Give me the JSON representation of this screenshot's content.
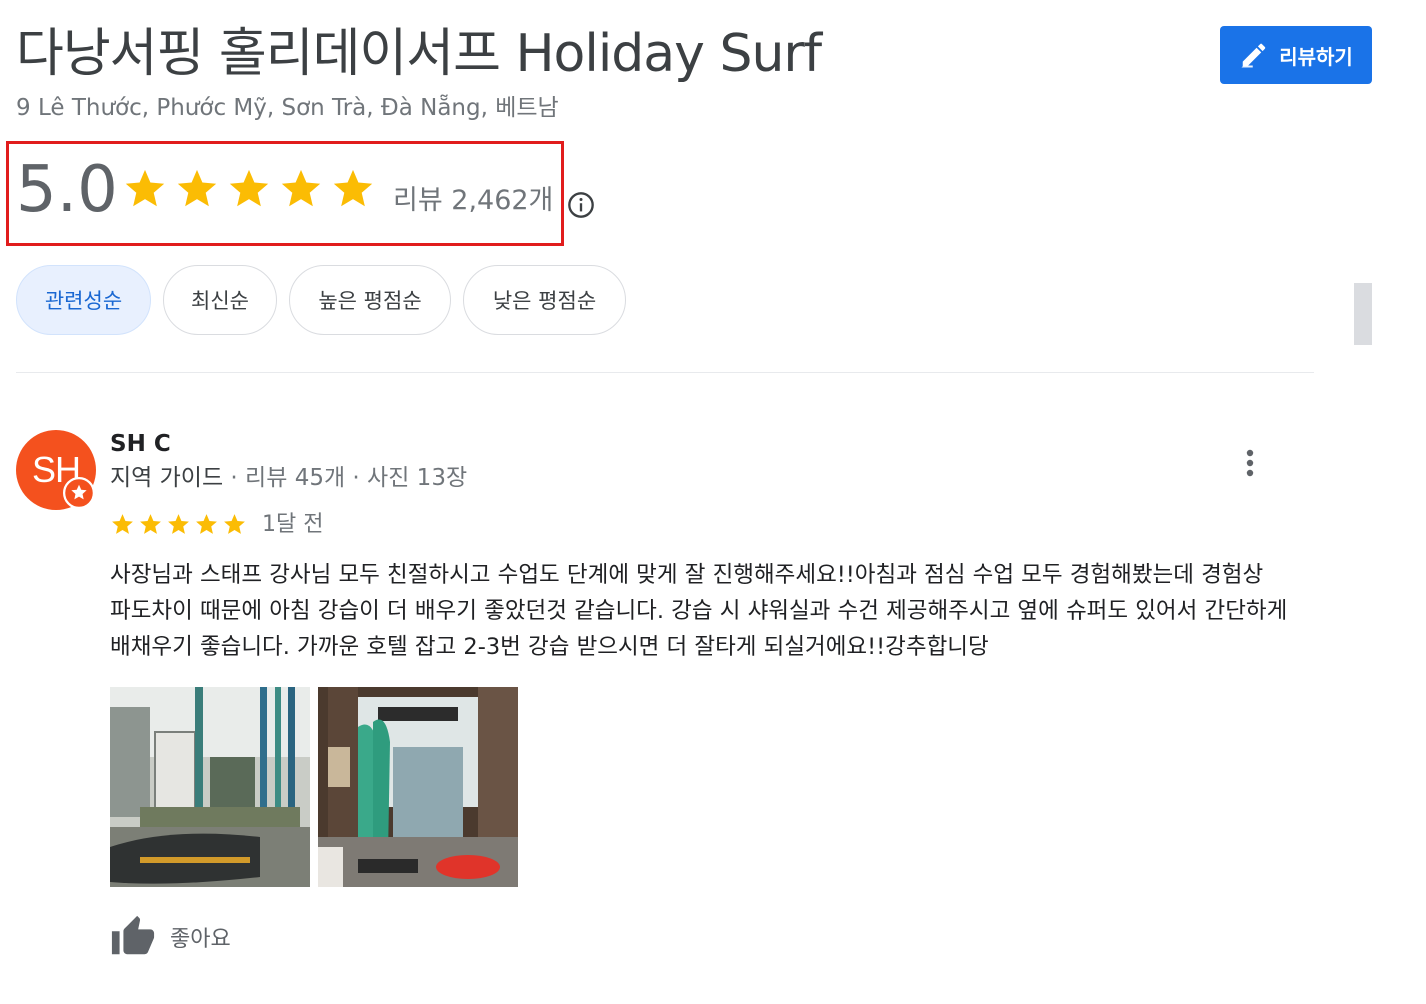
{
  "place": {
    "title": "다낭서핑 홀리데이서프 Holiday Surf",
    "address": "9 Lê Thước, Phước Mỹ, Sơn Trà, Đà Nẵng, 베트남"
  },
  "write_review": {
    "label": "리뷰하기",
    "icon": "pencil-icon"
  },
  "rating": {
    "value": "5.0",
    "stars": 5,
    "review_count_label": "리뷰 2,462개",
    "info_icon": "info-icon",
    "highlight_color": "#e11d1d"
  },
  "sort_chips": [
    {
      "label": "관련성순",
      "active": true
    },
    {
      "label": "최신순",
      "active": false
    },
    {
      "label": "높은 평점순",
      "active": false
    },
    {
      "label": "낮은 평점순",
      "active": false
    }
  ],
  "review": {
    "avatar_text": "SH",
    "avatar_color": "#f4511e",
    "reviewer_name": "SH C",
    "guide_label": "지역 가이드",
    "meta": " · 리뷰 45개 · 사진 13장",
    "stars": 5,
    "time": "1달 전",
    "text": "사장님과 스태프 강사님 모두 친절하시고 수업도 단계에 맞게 잘 진행해주세요!!아침과 점심 수업 모두 경험해봤는데 경험상 파도차이 때문에 아침 강습이 더 배우기 좋았던것 같습니다. 강습 시 샤워실과 수건 제공해주시고 옆에 슈퍼도 있어서 간단하게 배채우기 좋습니다. 가까운 호텔 잡고 2-3번 강습 받으시면 더 잘타게 되실거에요!!강추합니당",
    "photos": [
      "surf-shop-exterior-photo",
      "surf-shop-interior-photo"
    ],
    "like_label": "좋아요"
  },
  "colors": {
    "accent": "#1a73e8",
    "star": "#fbbc04",
    "chip_active_bg": "#e8f0fe",
    "chip_active_text": "#1967d2"
  }
}
